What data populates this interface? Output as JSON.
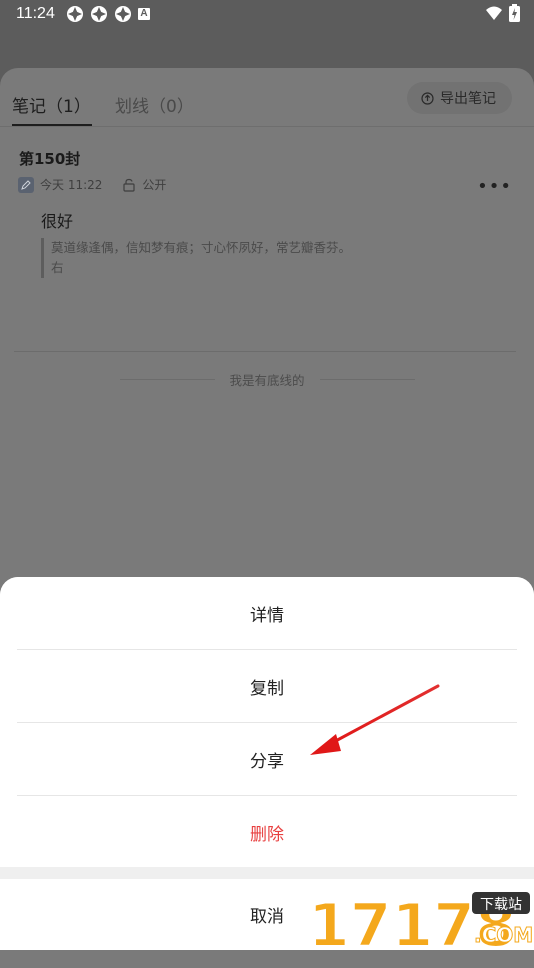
{
  "status_bar": {
    "time": "11:24",
    "icons_left": [
      "app-icon",
      "app-icon",
      "app-icon",
      "a-badge-icon"
    ],
    "a_badge": "A",
    "icons_right": [
      "wifi-icon",
      "battery-charging-icon"
    ]
  },
  "tabs": {
    "notes_label": "笔记（1）",
    "highlights_label": "划线（0）",
    "export_label": "导出笔记"
  },
  "note": {
    "title": "第150封",
    "time": "今天 11:22",
    "visibility": "公开",
    "content": "很好",
    "quote_line1": "莫道缘逢偶，信知梦有痕；寸心怀夙好，常艺瓣香芬。",
    "quote_line2": "右"
  },
  "footer_text": "我是有底线的",
  "action_sheet": {
    "details": "详情",
    "copy": "复制",
    "share": "分享",
    "delete": "删除",
    "cancel": "取消"
  },
  "watermark": {
    "text": "17178",
    "sub": ".COM",
    "tag": "下载站"
  },
  "colors": {
    "delete": "#e84040",
    "arrow": "#e02020",
    "watermark_main": "#f4a81c",
    "watermark_sub": "#ffffff"
  }
}
